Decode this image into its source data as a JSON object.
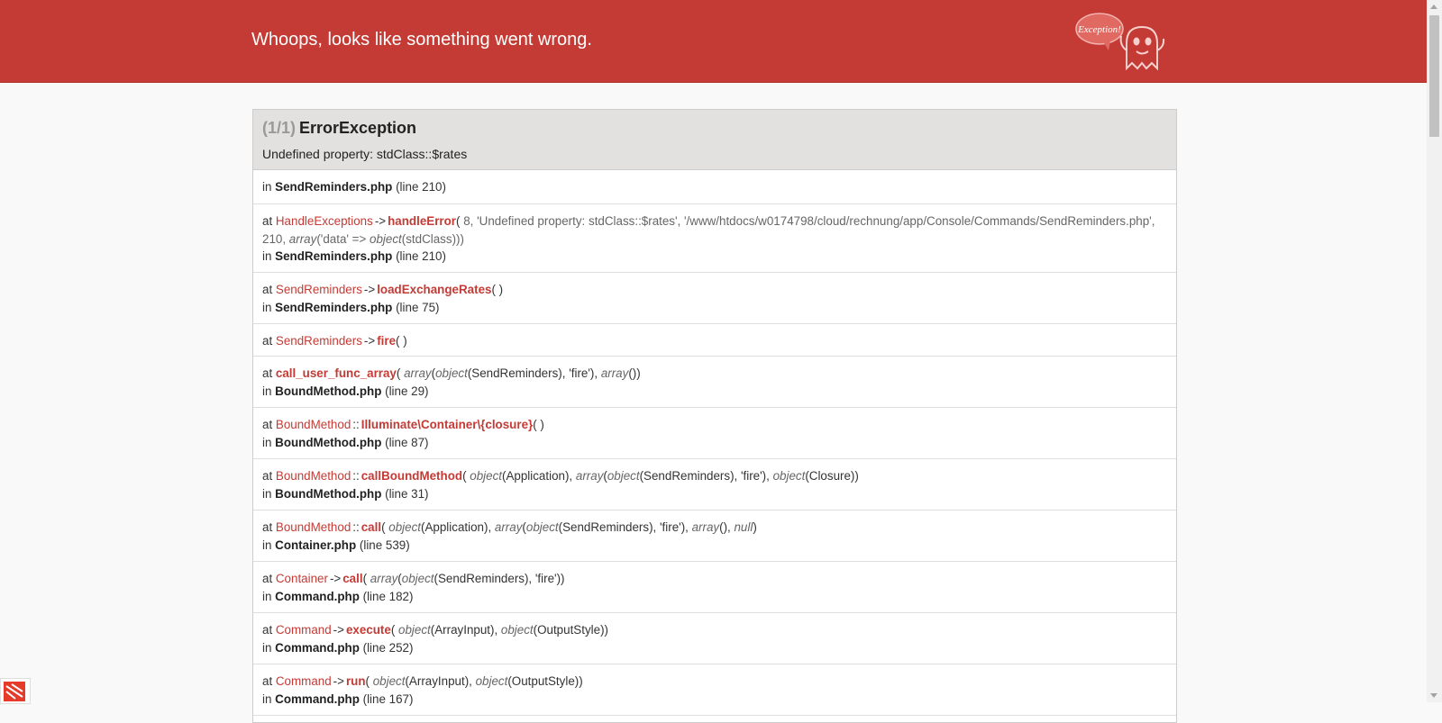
{
  "header": {
    "title": "Whoops, looks like something went wrong.",
    "mascot_bubble": "Exception!"
  },
  "exception": {
    "count": "(1/1)",
    "name": "ErrorException",
    "message": "Undefined property: stdClass::$rates"
  },
  "frames": [
    {
      "kind": "in",
      "file": "SendReminders.php",
      "line": "(line 210)"
    },
    {
      "kind": "at",
      "class": "HandleExceptions",
      "sep": "->",
      "func": "handleError",
      "args_html": "<span class=\"args\">8, 'Undefined property: stdClass::$rates', '/www/htdocs/w0174798/cloud/rechnung/app/Console/Commands/SendReminders.php', 210, <span class=\"it\">array</span>('data' =&gt; <span class=\"it\">object</span>(stdClass)))</span>",
      "file": "SendReminders.php",
      "line": "(line 210)"
    },
    {
      "kind": "at",
      "class": "SendReminders",
      "sep": "->",
      "func": "loadExchangeRates",
      "args": "( )",
      "file": "SendReminders.php",
      "line": "(line 75)"
    },
    {
      "kind": "at",
      "class": "SendReminders",
      "sep": "->",
      "func": "fire",
      "args": "( )"
    },
    {
      "kind": "at",
      "class": "",
      "sep": "",
      "func": "call_user_func_array",
      "args_html": "<span class=\"it\">array</span>(<span class=\"it\">object</span>(SendReminders), 'fire'), <span class=\"it\">array</span>())",
      "file": "BoundMethod.php",
      "line": "(line 29)"
    },
    {
      "kind": "at",
      "class": "BoundMethod",
      "sep": "::",
      "func": "Illuminate\\Container\\{closure}",
      "args": "( )",
      "file": "BoundMethod.php",
      "line": "(line 87)"
    },
    {
      "kind": "at",
      "class": "BoundMethod",
      "sep": "::",
      "func": "callBoundMethod",
      "args_html": "<span class=\"it\">object</span>(Application), <span class=\"it\">array</span>(<span class=\"it\">object</span>(SendReminders), 'fire'), <span class=\"it\">object</span>(Closure))",
      "file": "BoundMethod.php",
      "line": "(line 31)"
    },
    {
      "kind": "at",
      "class": "BoundMethod",
      "sep": "::",
      "func": "call",
      "args_html": "<span class=\"it\">object</span>(Application), <span class=\"it\">array</span>(<span class=\"it\">object</span>(SendReminders), 'fire'), <span class=\"it\">array</span>(), <span class=\"it\">null</span>)",
      "file": "Container.php",
      "line": "(line 539)"
    },
    {
      "kind": "at",
      "class": "Container",
      "sep": "->",
      "func": "call",
      "args_html": "<span class=\"it\">array</span>(<span class=\"it\">object</span>(SendReminders), 'fire'))",
      "file": "Command.php",
      "line": "(line 182)"
    },
    {
      "kind": "at",
      "class": "Command",
      "sep": "->",
      "func": "execute",
      "args_html": "<span class=\"it\">object</span>(ArrayInput), <span class=\"it\">object</span>(OutputStyle))",
      "file": "Command.php",
      "line": "(line 252)"
    },
    {
      "kind": "at",
      "class": "Command",
      "sep": "->",
      "func": "run",
      "args_html": "<span class=\"it\">object</span>(ArrayInput), <span class=\"it\">object</span>(OutputStyle))",
      "file": "Command.php",
      "line": "(line 167)"
    }
  ],
  "labels": {
    "at": "at",
    "in": "in"
  },
  "colors": {
    "header": "#c43b35",
    "accent": "#c43b35",
    "panel_head": "#e2e1df"
  }
}
